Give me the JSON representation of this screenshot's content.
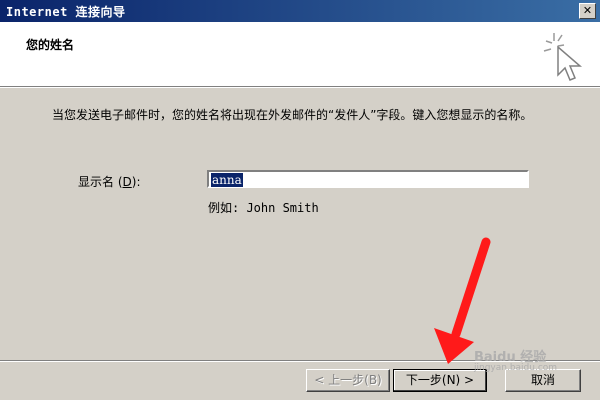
{
  "window": {
    "title": "Internet 连接向导",
    "close_label": "✕"
  },
  "header": {
    "heading": "您的姓名"
  },
  "main": {
    "description": "当您发送电子邮件时，您的姓名将出现在外发邮件的“发件人”字段。键入您想显示的名称。",
    "display_name_label": "显示名",
    "display_name_accel": "D",
    "display_name_value": "anna",
    "example_text": "例如: John Smith"
  },
  "footer": {
    "back_label": "< 上一步(B)",
    "next_label": "下一步(N) >",
    "cancel_label": "取消"
  },
  "overlay": {
    "arrow_color": "#ff1a1a",
    "watermark_text": "Baidu 经验",
    "watermark_url": "jingyan.baidu.com"
  },
  "icons": {
    "close": "close-icon",
    "wizard": "cursor-sparkle-icon",
    "arrow": "red-arrow-icon"
  },
  "colors": {
    "titlebar": "#0a246a",
    "dialog_bg": "#d4d0c8",
    "selection": "#0a246a"
  }
}
